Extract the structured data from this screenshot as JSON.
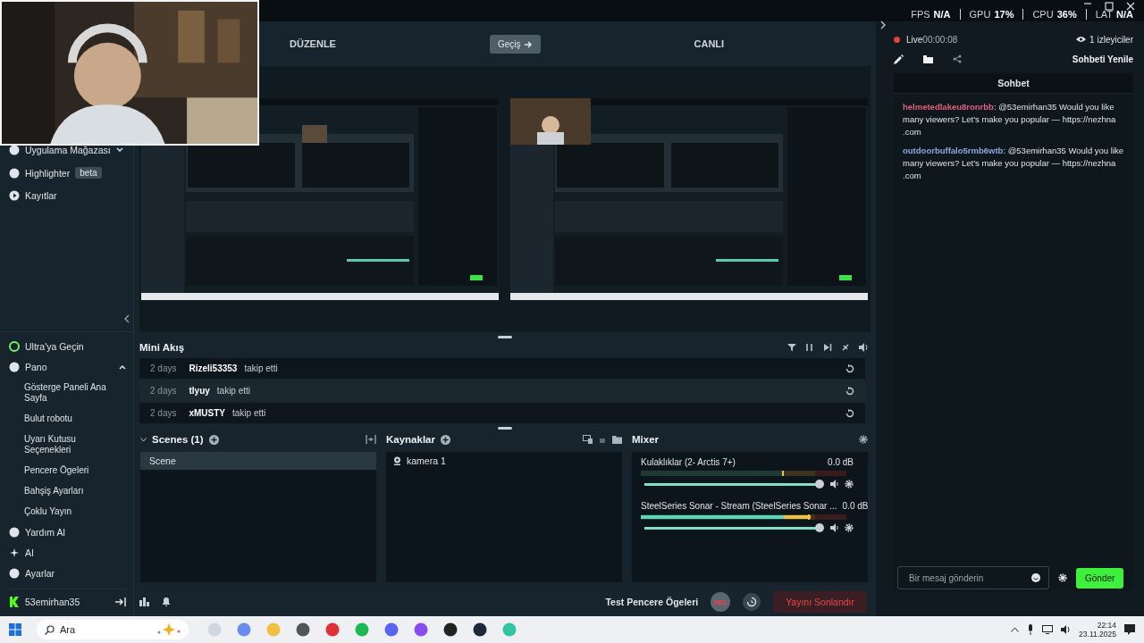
{
  "stats": [
    {
      "label": "FPS",
      "value": "N/A"
    },
    {
      "label": "GPU",
      "value": "17%"
    },
    {
      "label": "CPU",
      "value": "36%"
    },
    {
      "label": "LAT",
      "value": "N/A"
    }
  ],
  "sidebar": {
    "top_items": [
      {
        "label": "Uygulama Mağazası",
        "expanded": false
      },
      {
        "label": "Highlighter",
        "badge": "beta"
      },
      {
        "label": "Kayıtlar"
      }
    ],
    "bottom_items": [
      {
        "label": "Ultra'ya Geçin"
      },
      {
        "label": "Pano",
        "expanded": true,
        "children": [
          {
            "label": "Gösterge Paneli Ana Sayfa"
          },
          {
            "label": "Bulut robotu"
          },
          {
            "label": "Uyarı Kutusu Seçenekleri"
          },
          {
            "label": "Pencere Ögeleri"
          },
          {
            "label": "Bahşiş Ayarları"
          },
          {
            "label": "Çoklu Yayın"
          }
        ]
      },
      {
        "label": "Yardım Al"
      },
      {
        "label": "AI"
      },
      {
        "label": "Ayarlar"
      }
    ],
    "account": "53emirhan35"
  },
  "studio": {
    "edit_label": "DÜZENLE",
    "transition_button": "Geçiş",
    "live_label": "CANLI"
  },
  "mini_feed": {
    "title": "Mini Akış",
    "events": [
      {
        "time": "2 days",
        "user": "Rizeli53353",
        "action": "takip etti"
      },
      {
        "time": "2 days",
        "user": "tlyuy",
        "action": "takip etti"
      },
      {
        "time": "2 days",
        "user": "xMUSTY",
        "action": "takip etti"
      }
    ]
  },
  "scenes": {
    "title": "Scenes (1)",
    "items": [
      {
        "name": "Scene",
        "selected": true
      }
    ]
  },
  "sources": {
    "title": "Kaynaklar",
    "items": [
      {
        "name": "kamera 1"
      }
    ]
  },
  "mixer": {
    "title": "Mixer",
    "channels": [
      {
        "name": "Kulaklıklar (2- Arctis 7+)",
        "reading": "0.0 dB",
        "level": 1.0
      },
      {
        "name": "SteelSeries Sonar - Stream (SteelSeries Sonar ...",
        "reading": "0.0 dB",
        "level": 1.0
      }
    ]
  },
  "footer": {
    "test_widgets": "Test Pencere Ögeleri",
    "rec": "REC",
    "end_stream": "Yayını Sonlandır"
  },
  "chat": {
    "live_label": "Live",
    "live_time": "00:00:08",
    "viewers": "1 izleyiciler",
    "refresh": "Sohbeti Yenile",
    "title": "Sohbet",
    "messages": [
      {
        "user": "helmetedlakeu8ronrbb",
        "color": "#e0607e",
        "text": ": @53emirhan35 Would you like many viewers? Let's make you popular — https://nezhna .com"
      },
      {
        "user": "outdoorbuffalo5rmb6wtb",
        "color": "#8fa6e0",
        "text": ": @53emirhan35 Would you like many viewers? Let's make you popular — https://nezhna .com"
      }
    ],
    "input_placeholder": "Bir mesaj gönderin",
    "send": "Gönder"
  },
  "taskbar": {
    "search_placeholder": "Ara",
    "time": "22:14",
    "date": "23.11.2025"
  }
}
